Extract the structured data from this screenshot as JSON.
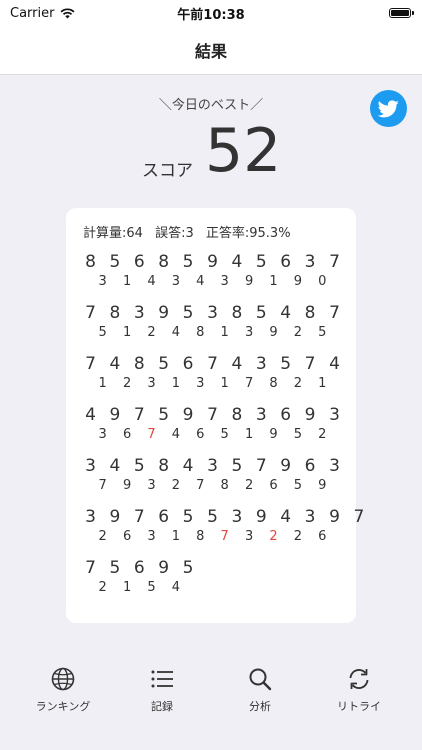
{
  "status": {
    "carrier": "Carrier",
    "time": "午前10:38"
  },
  "nav": {
    "title": "結果"
  },
  "best_label": "＼今日のベスト／",
  "score": {
    "label": "スコア",
    "value": "52"
  },
  "stats": {
    "calc": "計算量:64",
    "errors": "誤答:3",
    "accuracy": "正答率:95.3%"
  },
  "rows": [
    {
      "top": [
        "8",
        "5",
        "6",
        "8",
        "5",
        "9",
        "4",
        "5",
        "6",
        "3",
        "7"
      ],
      "bottom": [
        "3",
        "1",
        "4",
        "3",
        "4",
        "3",
        "9",
        "1",
        "9",
        "0"
      ],
      "wrong": []
    },
    {
      "top": [
        "7",
        "8",
        "3",
        "9",
        "5",
        "3",
        "8",
        "5",
        "4",
        "8",
        "7"
      ],
      "bottom": [
        "5",
        "1",
        "2",
        "4",
        "8",
        "1",
        "3",
        "9",
        "2",
        "5"
      ],
      "wrong": []
    },
    {
      "top": [
        "7",
        "4",
        "8",
        "5",
        "6",
        "7",
        "4",
        "3",
        "5",
        "7",
        "4"
      ],
      "bottom": [
        "1",
        "2",
        "3",
        "1",
        "3",
        "1",
        "7",
        "8",
        "2",
        "1"
      ],
      "wrong": []
    },
    {
      "top": [
        "4",
        "9",
        "7",
        "5",
        "9",
        "7",
        "8",
        "3",
        "6",
        "9",
        "3"
      ],
      "bottom": [
        "3",
        "6",
        "7",
        "4",
        "6",
        "5",
        "1",
        "9",
        "5",
        "2"
      ],
      "wrong": [
        2
      ]
    },
    {
      "top": [
        "3",
        "4",
        "5",
        "8",
        "4",
        "3",
        "5",
        "7",
        "9",
        "6",
        "3"
      ],
      "bottom": [
        "7",
        "9",
        "3",
        "2",
        "7",
        "8",
        "2",
        "6",
        "5",
        "9"
      ],
      "wrong": []
    },
    {
      "top": [
        "3",
        "9",
        "7",
        "6",
        "5",
        "5",
        "3",
        "9",
        "4",
        "3",
        "9",
        "7"
      ],
      "bottom": [
        "2",
        "6",
        "3",
        "1",
        "8",
        "7",
        "3",
        "2",
        "2",
        "6"
      ],
      "wrong": [
        5,
        7
      ]
    },
    {
      "top": [
        "7",
        "5",
        "6",
        "9",
        "5"
      ],
      "bottom": [
        "2",
        "1",
        "5",
        "4"
      ],
      "wrong": []
    }
  ],
  "tabs": [
    {
      "label": "ランキング",
      "icon": "globe-icon"
    },
    {
      "label": "記録",
      "icon": "list-icon"
    },
    {
      "label": "分析",
      "icon": "magnifier-icon"
    },
    {
      "label": "リトライ",
      "icon": "retry-icon"
    }
  ],
  "colors": {
    "accent_twitter": "#1d9bf0",
    "wrong_digit": "#e0483e",
    "background": "#f0eff5"
  }
}
